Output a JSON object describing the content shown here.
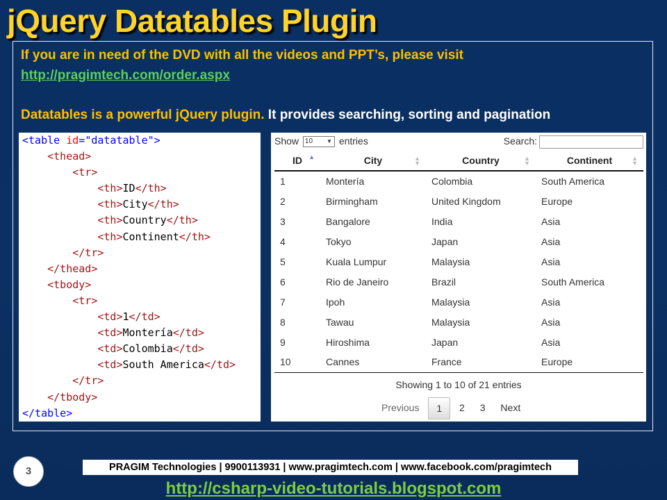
{
  "slide": {
    "title": "jQuery Datatables Plugin",
    "intro_line1": "If you are in need of the DVD with all the videos and PPT’s, please visit",
    "intro_link": "http://pragimtech.com/order.aspx",
    "intro_line3_yellow": "Datatables is a powerful jQuery plugin.",
    "intro_line3_white": " It provides searching, sorting and pagination",
    "slide_number": "3",
    "footer_bar": "PRAGIM Technologies | 9900113931 | www.pragimtech.com | www.facebook.com/pragimtech",
    "footer_link": "http://csharp-video-tutorials.blogspot.com"
  },
  "code": {
    "l1_open": "<table ",
    "l1_attr": "id",
    "l1_eq": "=",
    "l1_val": "\"datatable\"",
    "l1_close": ">",
    "l2": "<thead>",
    "l3": "<tr>",
    "th_open": "<th>",
    "th_close": "</th>",
    "th1": "ID",
    "th2": "City",
    "th3": "Country",
    "th4": "Continent",
    "tr_close": "</tr>",
    "thead_close": "</thead>",
    "tbody_open": "<tbody>",
    "td_open": "<td>",
    "td_close": "</td>",
    "td1": "1",
    "td2": "Montería",
    "td3": "Colombia",
    "td4": "South America",
    "tbody_close": "</tbody>",
    "table_close": "</table>"
  },
  "datatable": {
    "length_label_pre": "Show",
    "length_value": "10",
    "length_label_post": "entries",
    "search_label": "Search:",
    "search_value": "",
    "columns": [
      "ID",
      "City",
      "Country",
      "Continent"
    ],
    "sorted_column": "ID",
    "sort_direction": "ascending",
    "rows": [
      [
        "1",
        "Montería",
        "Colombia",
        "South America"
      ],
      [
        "2",
        "Birmingham",
        "United Kingdom",
        "Europe"
      ],
      [
        "3",
        "Bangalore",
        "India",
        "Asia"
      ],
      [
        "4",
        "Tokyo",
        "Japan",
        "Asia"
      ],
      [
        "5",
        "Kuala Lumpur",
        "Malaysia",
        "Asia"
      ],
      [
        "6",
        "Rio de Janeiro",
        "Brazil",
        "South America"
      ],
      [
        "7",
        "Ipoh",
        "Malaysia",
        "Asia"
      ],
      [
        "8",
        "Tawau",
        "Malaysia",
        "Asia"
      ],
      [
        "9",
        "Hiroshima",
        "Japan",
        "Asia"
      ],
      [
        "10",
        "Cannes",
        "France",
        "Europe"
      ]
    ],
    "info": "Showing 1 to 10 of 21 entries",
    "pager": {
      "previous": "Previous",
      "pages": [
        "1",
        "2",
        "3"
      ],
      "current_page": "1",
      "next": "Next"
    }
  },
  "colors": {
    "title": "#ffd42a",
    "intro_text": "#ffc000",
    "link": "#5bd05b",
    "background": "#0a2f63"
  }
}
